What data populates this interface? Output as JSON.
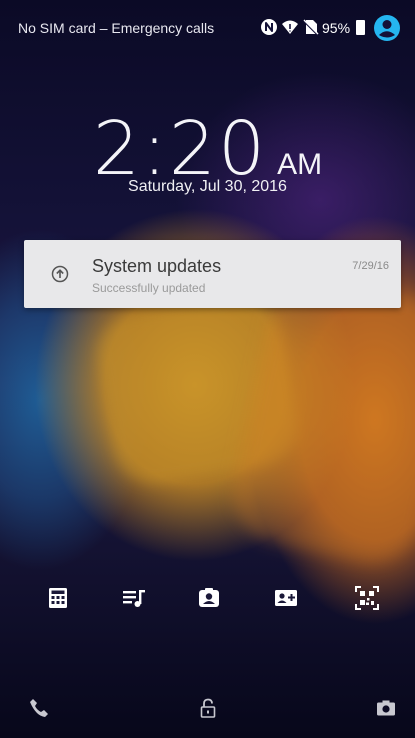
{
  "status_bar": {
    "carrier_text": "No SIM card – Emergency calls",
    "battery_percent": "95%",
    "icons": [
      "nfc-icon",
      "wifi-icon",
      "no-sim-icon",
      "battery-icon",
      "user-icon"
    ]
  },
  "lockscreen": {
    "time": "2:20",
    "ampm": "AM",
    "date": "Saturday, Jul 30, 2016"
  },
  "notification": {
    "title": "System updates",
    "subtitle": "Successfully updated",
    "date": "7/29/16",
    "icon": "system-update-icon"
  },
  "shortcuts": [
    "calculator-icon",
    "music-playlist-icon",
    "selfie-camera-icon",
    "add-contact-icon",
    "qr-scanner-icon"
  ],
  "bottom_bar": [
    "phone-icon",
    "lock-icon",
    "camera-icon"
  ],
  "colors": {
    "notification_bg": "#e8e8ea",
    "user_icon_accent": "#25b6f0",
    "text_primary": "#ffffff"
  }
}
